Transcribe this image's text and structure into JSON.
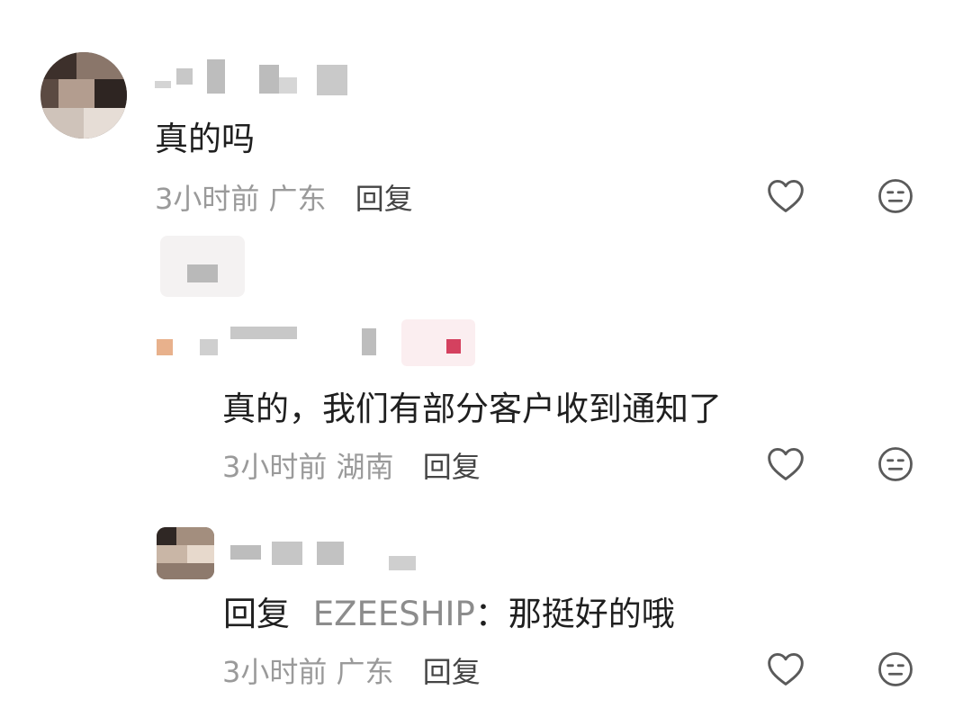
{
  "comments": [
    {
      "text": "真的吗",
      "time": "3小时前",
      "location": "广东",
      "reply_label": "回复"
    },
    {
      "text": "真的，我们有部分客户收到通知了",
      "time": "3小时前",
      "location": "湖南",
      "reply_label": "回复"
    },
    {
      "reply_prefix": "回复",
      "mention": "EZEESHIP",
      "separator": "：",
      "text": "那挺好的哦",
      "time": "3小时前",
      "location": "广东",
      "reply_label": "回复"
    }
  ],
  "icons": {
    "like": "heart-outline-icon",
    "dislike": "neutral-face-icon"
  },
  "colors": {
    "text": "#1f1f1f",
    "meta": "#9a9a9a",
    "reply": "#454545",
    "icon": "#5a5a5a"
  }
}
